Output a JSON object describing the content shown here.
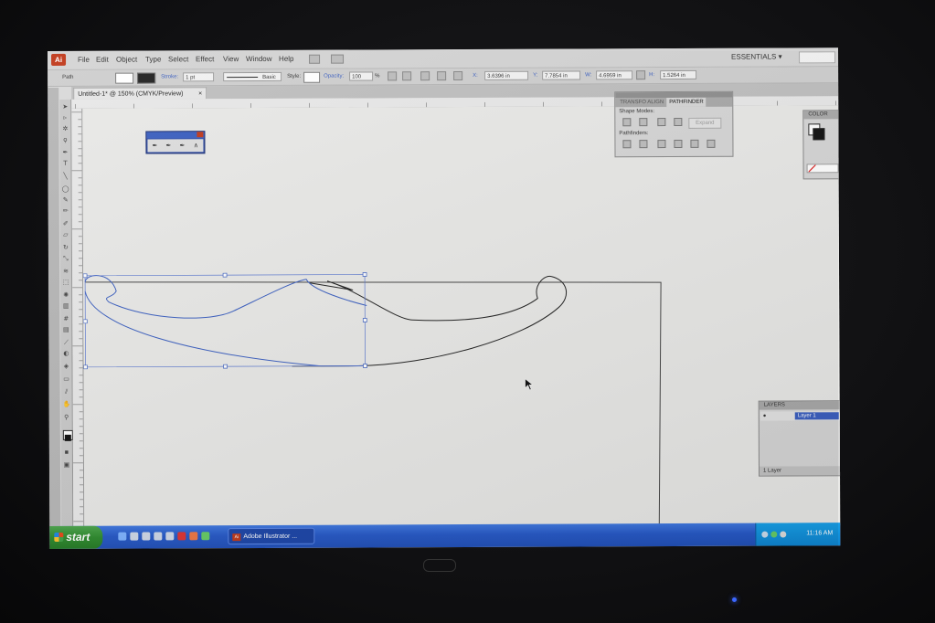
{
  "app": {
    "logo": "Ai",
    "menu": [
      "File",
      "Edit",
      "Object",
      "Type",
      "Select",
      "Effect",
      "View",
      "Window",
      "Help"
    ],
    "workspace": "ESSENTIALS ▾"
  },
  "control_bar": {
    "selection_type": "Path",
    "stroke_label": "Stroke:",
    "stroke_value": "1 pt",
    "brush_label": "Basic",
    "style_label": "Style:",
    "opacity_label": "Opacity:",
    "opacity_value": "100",
    "opacity_unit": "%",
    "x_label": "X:",
    "x_value": "3.6396 in",
    "y_label": "Y:",
    "y_value": "7.7854 in",
    "w_label": "W:",
    "w_value": "4.6959 in",
    "h_label": "H:",
    "h_value": "1.5264 in"
  },
  "document_tab": {
    "title": "Untitled-1* @ 150% (CMYK/Preview)",
    "close": "×"
  },
  "pathfinder_panel": {
    "tab_align": "TRANSFO ALIGN",
    "tab_pathfinder": "PATHFINDER",
    "shape_modes_label": "Shape Modes:",
    "expand_label": "Expand",
    "pathfinders_label": "Pathfinders:"
  },
  "color_panel": {
    "title": "COLOR",
    "fill_color": "#ffffff",
    "stroke_color": "#111111"
  },
  "layers_panel": {
    "title": "LAYERS",
    "layer_name": "Layer 1",
    "footer_count": "1 Layer"
  },
  "taskbar": {
    "start_label": "start",
    "task_label": "Adobe Illustrator ...",
    "clock": "11:16 AM"
  },
  "colors": {
    "accent_blue": "#3b5fc0",
    "ai_orange": "#c0391b",
    "taskbar_blue": "#2759c7",
    "start_green": "#2e8b2e"
  }
}
